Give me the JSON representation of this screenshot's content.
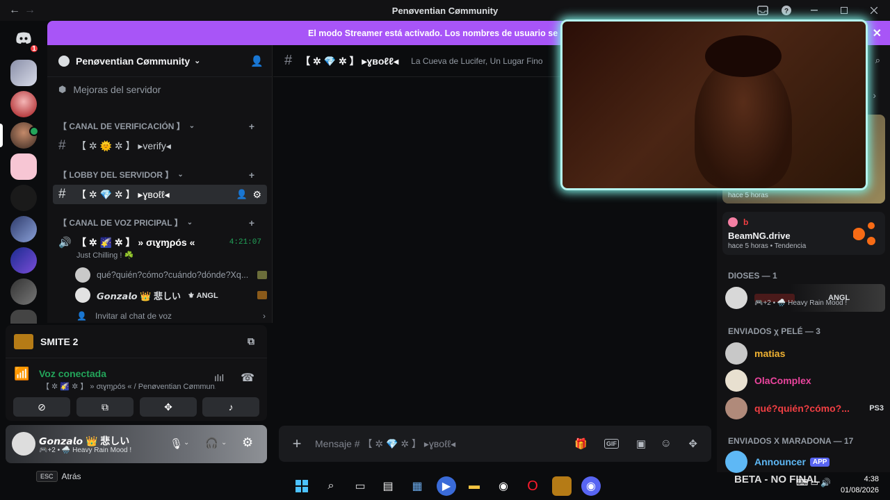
{
  "window": {
    "title": "Penøventian Cømmunity",
    "back_icon": "←",
    "forward_icon": "→"
  },
  "guilds": {
    "notification_count": "1"
  },
  "banner": {
    "text": "El modo Streamer está activado. Los nombres de usuario se mostrarán de for"
  },
  "server": {
    "name": "Penøventian Cømmunity",
    "boosts_label": "Mejoras del servidor",
    "categories": [
      {
        "label": "【 CANAL DE VERIFICACIÓN 】",
        "channel": "【 ✲ 🌞 ✲ 】 ▸verify◂"
      },
      {
        "label": "【 LOBBY DEL SERVIDOR 】",
        "channel": "【 ✲ 💎 ✲ 】 ▸ɣʙoℓℓ◂"
      },
      {
        "label": "【 CANAL DE VOZ PRICIPAL 】",
        "channel": "【 ✲ 🌠 ✲ 】 » σɩɣɱρós «"
      }
    ],
    "voice": {
      "timer": "4:21:07",
      "status": "Just Chilling ! ☘️",
      "users": [
        {
          "name": "qué?quién?cómo?cuándo?dónde?Xq..."
        },
        {
          "name": "𝙂𝙤𝙣𝙯𝙖𝙡𝙤 👑 悲しい",
          "tag": "ANGL"
        }
      ],
      "invite_label": "Invitar al chat de voz"
    }
  },
  "activity": {
    "game": "SMITE 2"
  },
  "voice_connection": {
    "status": "Voz conectada",
    "channel": "【 ✲ 🌠 ✲ 】 » σɩɣɱρós « / Penøventian Cømmun..."
  },
  "user": {
    "name": "𝙂𝙤𝙣𝙯𝙖𝙡𝙤 👑 悲しい",
    "status": "🎮+2 • 🌧️ Heavy Rain Mood !"
  },
  "channel_header": {
    "name": "【 ✲ 💎 ✲ 】 ▸ɣʙoℓℓ◂",
    "topic": "La Cueva de Lucifer, Un Lugar Fino"
  },
  "composer": {
    "placeholder": "Mensaje # 【 ✲ 💎 ✲ 】 ▸ɣʙoℓℓ◂"
  },
  "members": {
    "activity_cards": [
      {
        "title": "",
        "meta": "hace 5 horas"
      },
      {
        "label": "b",
        "title": "BeamNG.drive",
        "meta": "hace 5 horas • Tendencia"
      }
    ],
    "groups": [
      {
        "header": "DIOSES — 1",
        "members": [
          {
            "name": "",
            "tag": "ANGL",
            "status": "🎮+2 • 🌧️ Heavy Rain Mood !"
          }
        ]
      },
      {
        "header": "ENVIADOS χ PELÉ — 3",
        "members": [
          {
            "name": "matias",
            "color": "#f0b232"
          },
          {
            "name": "OlaComplex",
            "color": "#eb459e"
          },
          {
            "name": "qué?quién?cómo?...",
            "color": "#f23f43",
            "tag": "PS3"
          }
        ]
      },
      {
        "header": "ENVIADOS X MARADONA — 17",
        "members": [
          {
            "name": "Announcer",
            "color": "#5eb8f5",
            "tag": "APP"
          }
        ]
      }
    ]
  },
  "footer": {
    "esc": "ESC",
    "back": "Atrás",
    "beta_text": "BETA - NO FINAL",
    "time": "4:38",
    "date": "01/08/2026"
  },
  "colors": {
    "accent": "#a855f7",
    "connected": "#23a55a",
    "pip_glow": "#7ef3e8"
  }
}
